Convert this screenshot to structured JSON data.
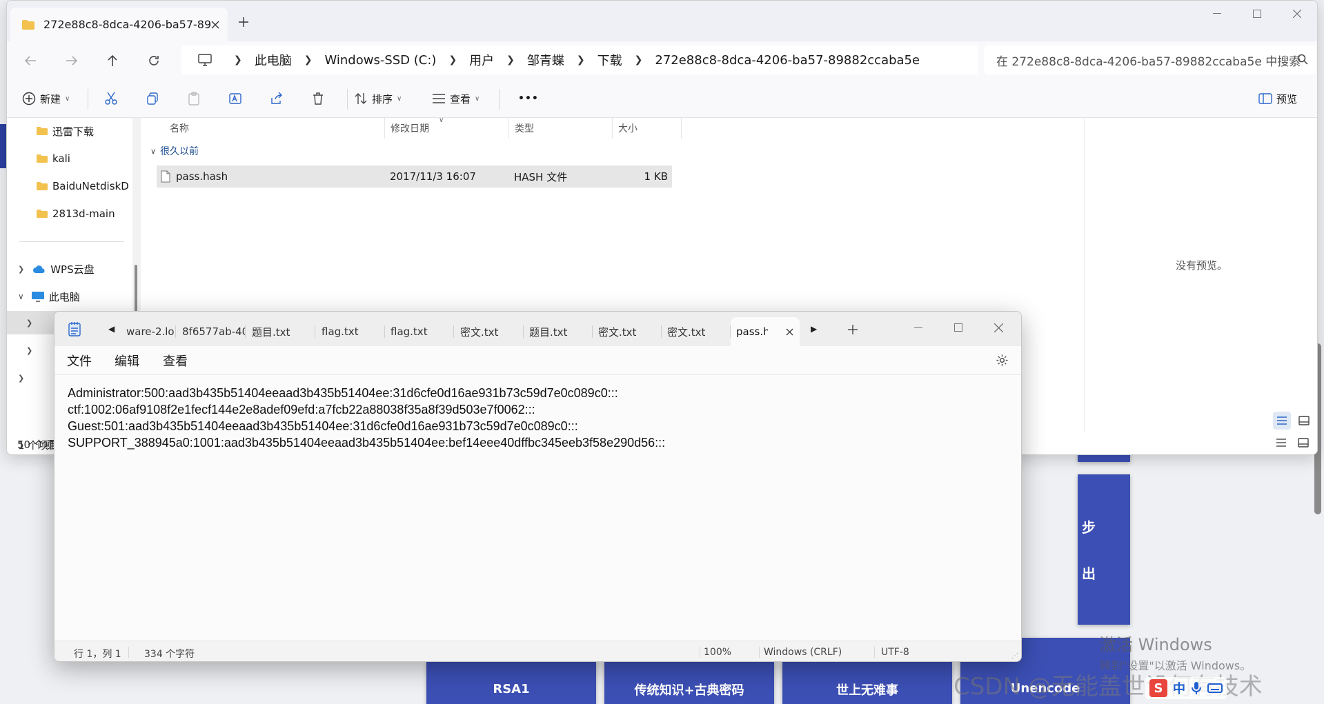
{
  "background": {
    "cards": [
      "RSA1",
      "传统知识+古典密码",
      "世上无难事",
      "Unencode"
    ],
    "side_card": {
      "line1": "步",
      "line2": "出"
    },
    "activation": {
      "title": "激活 Windows",
      "subtitle": "转到\"设置\"以激活 Windows。"
    },
    "watermark": "CSDN @无能盖世设何有技术",
    "ime": {
      "s": "S",
      "lang": "中"
    }
  },
  "explorer": {
    "tab_title": "272e88c8-8dca-4206-ba57-89",
    "address": [
      "此电脑",
      "Windows-SSD (C:)",
      "用户",
      "邹青蝶",
      "下载",
      "272e88c8-8dca-4206-ba57-89882ccaba5e"
    ],
    "search_placeholder": "在 272e88c8-8dca-4206-ba57-89882ccaba5e 中搜索",
    "toolbar": {
      "new": "新建",
      "sort": "排序",
      "view": "查看",
      "more": "•••",
      "preview": "预览"
    },
    "nav": {
      "folders": [
        "迅雷下载",
        "kali",
        "BaiduNetdiskD",
        "2813d-main"
      ],
      "wps": "WPS云盘",
      "this_pc": "此电脑"
    },
    "columns": [
      "名称",
      "修改日期",
      "类型",
      "大小"
    ],
    "group": "很久以前",
    "files": [
      {
        "name": "pass.hash",
        "date": "2017/11/3 16:07",
        "type": "HASH 文件",
        "size": "1 KB"
      }
    ],
    "status": "1 个项目",
    "preview_msg": "没有预览。"
  },
  "back_window": {
    "status": "50 个项"
  },
  "notepad": {
    "tabs": [
      "ware-2.lo",
      "8f6577ab-40",
      "题目.txt",
      "flag.txt",
      "flag.txt",
      "密文.txt",
      "题目.txt",
      "密文.txt",
      "密文.txt"
    ],
    "active_tab": "pass.h",
    "menu": {
      "file": "文件",
      "edit": "编辑",
      "view": "查看"
    },
    "lines": [
      "Administrator:500:aad3b435b51404eeaad3b435b51404ee:31d6cfe0d16ae931b73c59d7e0c089c0:::",
      "ctf:1002:06af9108f2e1fecf144e2e8adef09efd:a7fcb22a88038f35a8f39d503e7f0062:::",
      "Guest:501:aad3b435b51404eeaad3b435b51404ee:31d6cfe0d16ae931b73c59d7e0c089c0:::",
      "SUPPORT_388945a0:1001:aad3b435b51404eeaad3b435b51404ee:bef14eee40dffbc345eeb3f58e290d56:::"
    ],
    "status": {
      "position": "行 1，列 1",
      "chars": "334 个字符",
      "zoom": "100%",
      "eol": "Windows (CRLF)",
      "encoding": "UTF-8"
    }
  }
}
